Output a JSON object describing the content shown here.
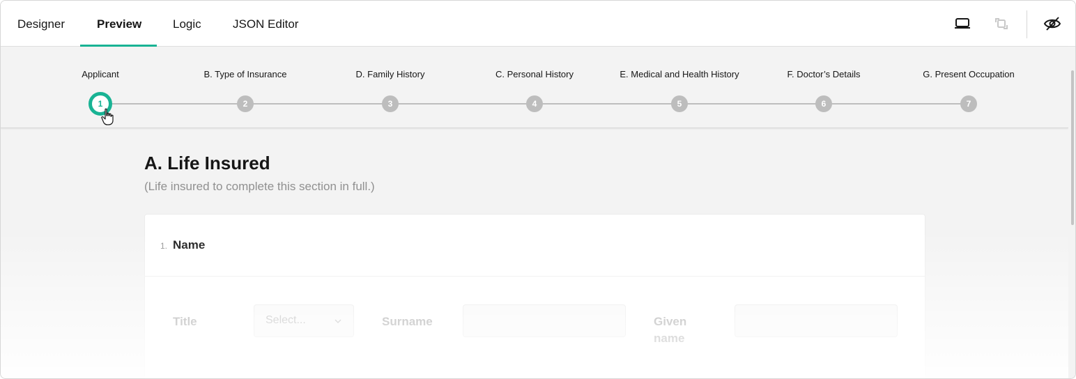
{
  "topbar": {
    "tabs": [
      {
        "label": "Designer"
      },
      {
        "label": "Preview"
      },
      {
        "label": "Logic"
      },
      {
        "label": "JSON Editor"
      }
    ],
    "active_tab": "Preview",
    "tools": [
      {
        "icon": "laptop-icon"
      },
      {
        "icon": "orientation-icon"
      },
      {
        "icon": "eye-off-icon"
      }
    ]
  },
  "stepper": {
    "steps": [
      {
        "label": "Applicant",
        "number": "1"
      },
      {
        "label": "B. Type of Insurance",
        "number": "2"
      },
      {
        "label": "D. Family History",
        "number": "3"
      },
      {
        "label": "C. Personal History",
        "number": "4"
      },
      {
        "label": "E. Medical and Health History",
        "number": "5"
      },
      {
        "label": "F. Doctor’s Details",
        "number": "6"
      },
      {
        "label": "G. Present Occupation",
        "number": "7"
      }
    ],
    "current_step": "1"
  },
  "page": {
    "title": "A. Life Insured",
    "description": "(Life insured to complete this section in full.)"
  },
  "question": {
    "number": "1.",
    "title": "Name",
    "fields": {
      "title_label": "Title",
      "title_placeholder": "Select...",
      "surname_label": "Surname",
      "given_name_label_line1": "Given",
      "given_name_label_line2": "name"
    }
  },
  "colors": {
    "accent": "#19b394",
    "inactive_step": "#bdbdbd",
    "background": "#f3f3f3"
  }
}
